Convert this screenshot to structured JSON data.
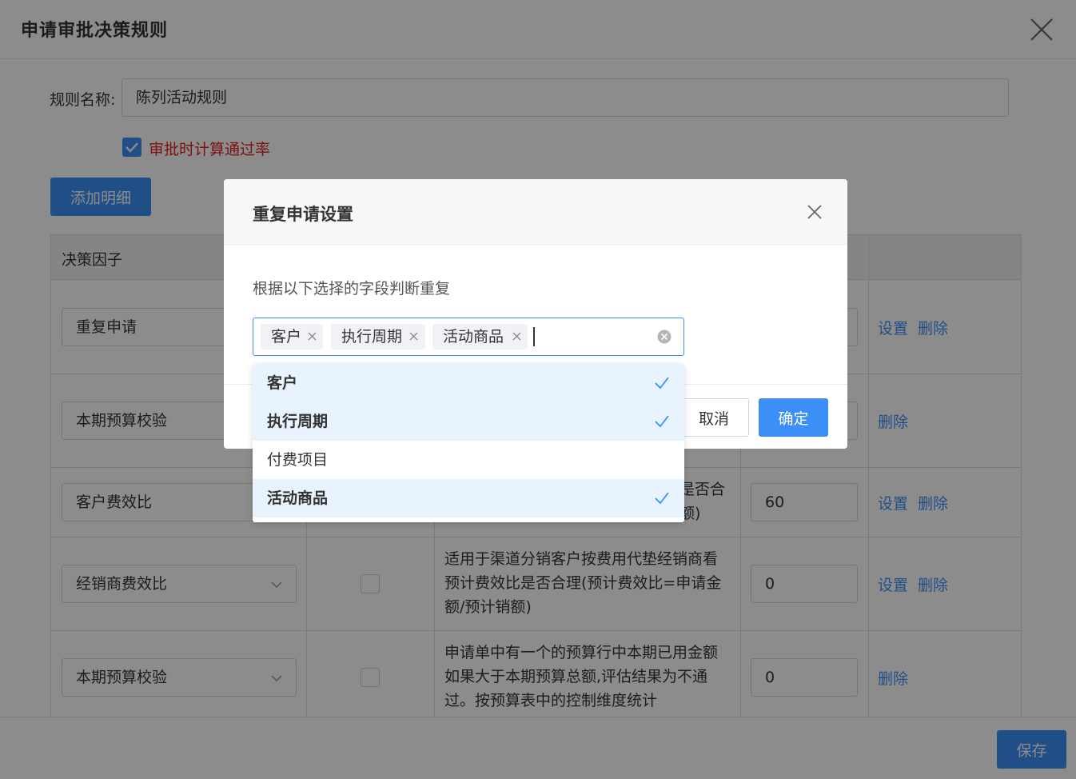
{
  "window": {
    "title": "申请审批决策规则"
  },
  "form": {
    "name_label": "规则名称:",
    "name_value": "陈列活动规则",
    "calc_checkbox_label": "审批时计算通过率",
    "add_button": "添加明细"
  },
  "table": {
    "header_factor": "决策因子",
    "rows": [
      {
        "factor": "重复申请",
        "desc": "",
        "value": "",
        "op_set": "设置",
        "op_delete": "删除"
      },
      {
        "factor": "本期预算校验",
        "desc": "",
        "value": "",
        "op_set": "",
        "op_delete": "删除"
      },
      {
        "factor": "客户费效比",
        "desc": "是否合\n额)",
        "value": "60",
        "op_set": "设置",
        "op_delete": "删除"
      },
      {
        "factor": "经销商费效比",
        "desc": "适用于渠道分销客户按费用代垫经销商看预计费效比是否合理(预计费效比=申请金额/预计销额)",
        "value": "0",
        "op_set": "设置",
        "op_delete": "删除"
      },
      {
        "factor": "本期预算校验",
        "desc": "申请单中有一个的预算行中本期已用金额如果大于本期预算总额,评估结果为不通过。按预算表中的控制维度统计",
        "value": "0",
        "op_set": "",
        "op_delete": "删除"
      }
    ]
  },
  "footer": {
    "save_button": "保存"
  },
  "dialog": {
    "title": "重复申请设置",
    "label": "根据以下选择的字段判断重复",
    "tags": [
      "客户",
      "执行周期",
      "活动商品"
    ],
    "options": [
      {
        "label": "客户",
        "selected": true
      },
      {
        "label": "执行周期",
        "selected": true
      },
      {
        "label": "付费项目",
        "selected": false
      },
      {
        "label": "活动商品",
        "selected": true
      }
    ],
    "cancel_button": "取消",
    "ok_button": "确定"
  },
  "colors": {
    "primary": "#3b8ff6",
    "danger": "#e02020",
    "selected_bg": "#e8f3fd"
  }
}
